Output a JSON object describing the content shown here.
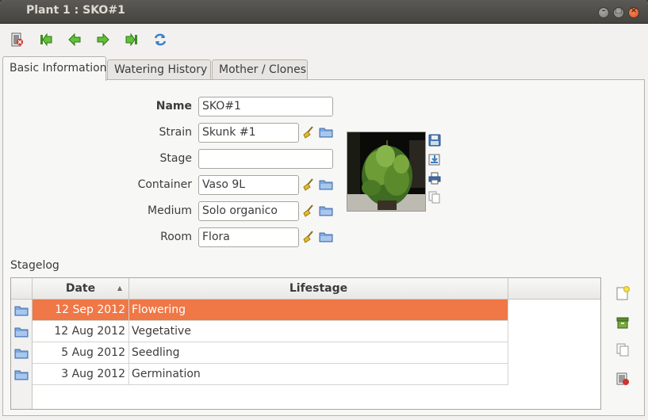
{
  "window": {
    "title": "Plant 1 : SKO#1"
  },
  "toolbar": {
    "buttons": [
      {
        "name": "exit-icon",
        "color": "#c0392b"
      },
      {
        "name": "first-record-icon",
        "color": "#4aa02c"
      },
      {
        "name": "previous-record-icon",
        "color": "#4aa02c"
      },
      {
        "name": "next-record-icon",
        "color": "#4aa02c"
      },
      {
        "name": "last-record-icon",
        "color": "#4aa02c"
      },
      {
        "name": "refresh-icon",
        "color": "#3a7fc8"
      }
    ]
  },
  "tabs": [
    {
      "label": "Basic Information",
      "active": true
    },
    {
      "label": "Watering History",
      "active": false
    },
    {
      "label": "Mother / Clones",
      "active": false
    }
  ],
  "form": {
    "name_label": "Name",
    "name_value": "SKO#1",
    "strain_label": "Strain",
    "strain_value": "Skunk #1",
    "stage_label": "Stage",
    "stage_value": "",
    "container_label": "Container",
    "container_value": "Vaso 9L",
    "medium_label": "Medium",
    "medium_value": "Solo organico",
    "room_label": "Room",
    "room_value": "Flora"
  },
  "stagelog": {
    "label": "Stagelog",
    "columns": {
      "date": "Date",
      "lifestage": "Lifestage"
    },
    "sort_indicator": "▲",
    "rows": [
      {
        "date": "12 Sep 2012",
        "lifestage": "Flowering",
        "selected": true
      },
      {
        "date": "12 Aug 2012",
        "lifestage": "Vegetative",
        "selected": false
      },
      {
        "date": "5 Aug 2012",
        "lifestage": "Seedling",
        "selected": false
      },
      {
        "date": "3 Aug 2012",
        "lifestage": "Germination",
        "selected": false
      }
    ]
  },
  "colors": {
    "selection": "#f07746",
    "titlebar": "#4b4a46",
    "close_button": "#e95420",
    "folder_icon": "#5b8fd0",
    "broom_icon": "#d8a417"
  }
}
